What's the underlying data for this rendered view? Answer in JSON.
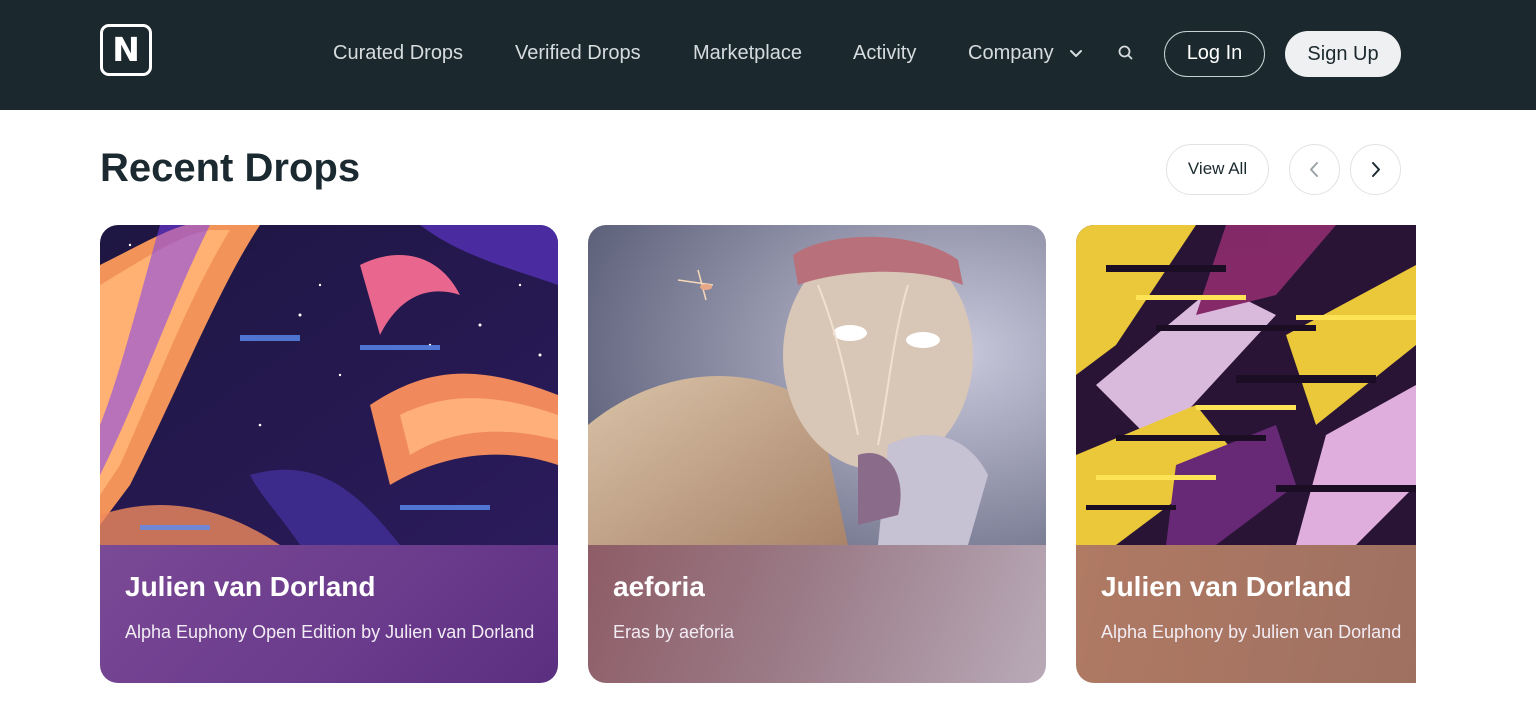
{
  "brand": {
    "logo_letter": "N"
  },
  "nav": {
    "items": [
      "Curated Drops",
      "Verified Drops",
      "Marketplace",
      "Activity",
      "Company"
    ],
    "login_label": "Log In",
    "signup_label": "Sign Up",
    "icons": {
      "search": "search-icon",
      "dropdown": "chevron-down-icon"
    }
  },
  "section": {
    "title": "Recent Drops",
    "view_all_label": "View All",
    "icons": {
      "prev": "chevron-left-icon",
      "next": "chevron-right-icon"
    }
  },
  "cards": [
    {
      "artist": "Julien van Dorland",
      "title": "Alpha Euphony Open Edition by Julien van Dorland",
      "accent": "#6a3a8c"
    },
    {
      "artist": "aeforia",
      "title": "Eras by aeforia",
      "accent": "#8e6a78"
    },
    {
      "artist": "Julien van Dorland",
      "title": "Alpha Euphony by Julien van Dorland",
      "accent": "#a87a66"
    }
  ],
  "colors": {
    "header_bg": "#1b292e",
    "text_dark": "#1b2a30"
  }
}
